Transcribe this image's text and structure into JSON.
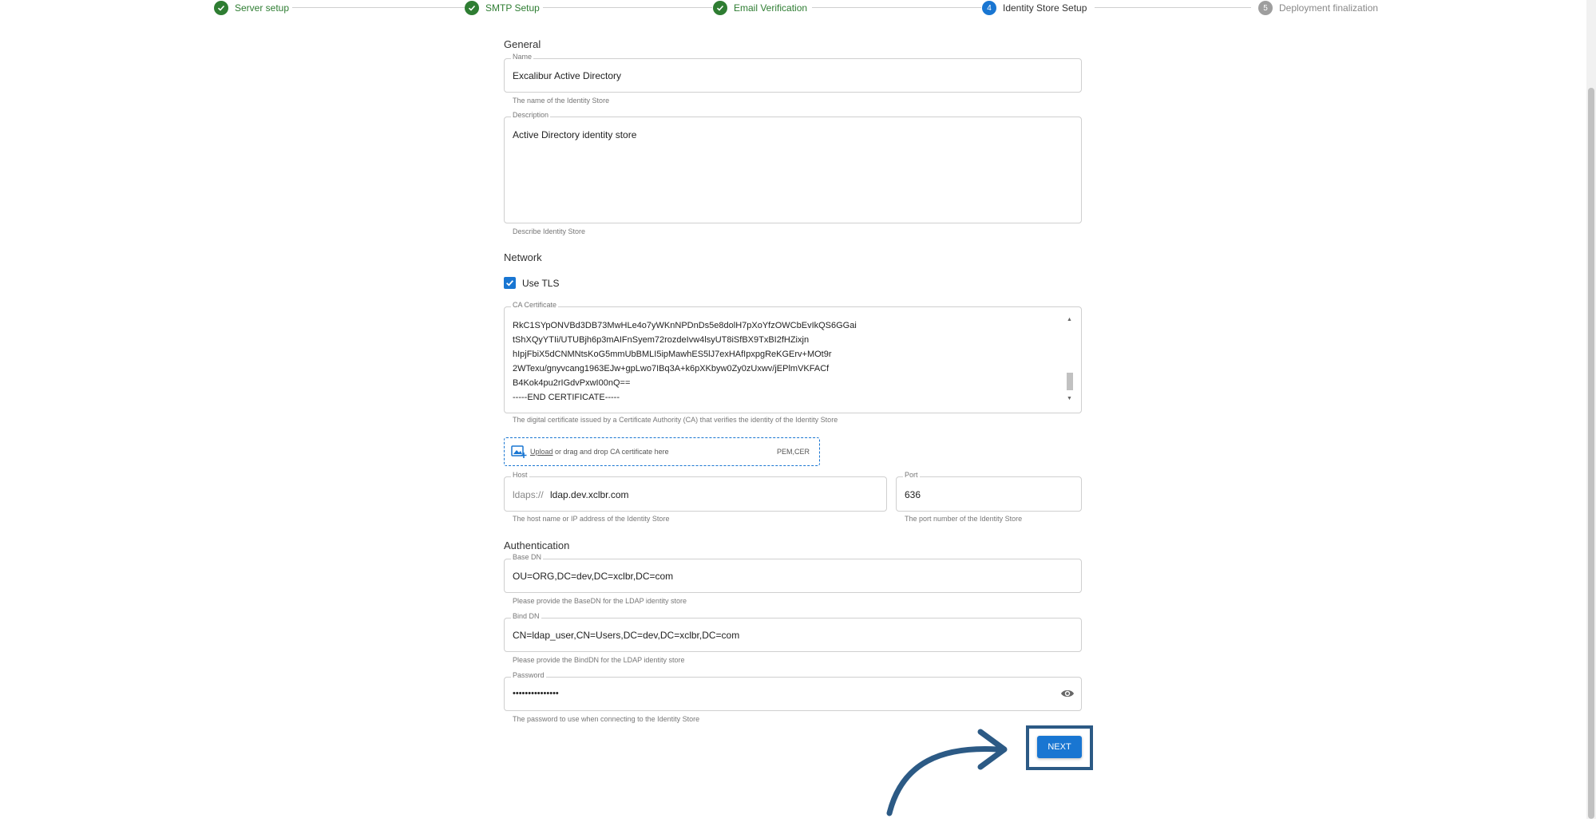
{
  "stepper": {
    "steps": [
      {
        "number": "1",
        "label": "Server setup",
        "state": "done"
      },
      {
        "number": "2",
        "label": "SMTP Setup",
        "state": "done"
      },
      {
        "number": "3",
        "label": "Email Verification",
        "state": "done"
      },
      {
        "number": "4",
        "label": "Identity Store Setup",
        "state": "active"
      },
      {
        "number": "5",
        "label": "Deployment finalization",
        "state": "pending"
      }
    ]
  },
  "general": {
    "title": "General",
    "name": {
      "label": "Name",
      "value": "Excalibur Active Directory",
      "helper": "The name of the Identity Store"
    },
    "description": {
      "label": "Description",
      "value": "Active Directory identity store",
      "helper": "Describe Identity Store"
    }
  },
  "network": {
    "title": "Network",
    "use_tls": {
      "label": "Use TLS",
      "checked": true
    },
    "ca_certificate": {
      "label": "CA Certificate",
      "lines": [
        "RkC1SYpONVBd3DB73MwHLe4o7yWKnNPDnDs5e8dolH7pXoYfzOWCbEvIkQS6GGai",
        "tShXQyYTIi/UTUBjh6p3mAIFnSyem72rozdeIvw4lsyUT8iSfBX9TxBI2fHZixjn",
        "hIpjFbiX5dCNMNtsKoG5mmUbBMLI5ipMawhES5lJ7exHAfIpxpgReKGErv+MOt9r",
        "2WTexu/gnyvcang1963EJw+gpLwo7IBq3A+k6pXKbyw0Zy0zUxwv/jEPlmVKFACf",
        "B4Kok4pu2rIGdvPxwI00nQ==",
        "-----END CERTIFICATE-----"
      ],
      "helper": "The digital certificate issued by a Certificate Authority (CA) that verifies the identity of the Identity Store"
    },
    "upload": {
      "link": "Upload",
      "text": " or drag and drop CA certificate here",
      "formats": "PEM,CER"
    },
    "host": {
      "label": "Host",
      "prefix": "ldaps://",
      "value": "ldap.dev.xclbr.com",
      "helper": "The host name or IP address of the Identity Store"
    },
    "port": {
      "label": "Port",
      "value": "636",
      "helper": "The port number of the Identity Store"
    }
  },
  "authentication": {
    "title": "Authentication",
    "base_dn": {
      "label": "Base DN",
      "value": "OU=ORG,DC=dev,DC=xclbr,DC=com",
      "helper": "Please provide the BaseDN for the LDAP identity store"
    },
    "bind_dn": {
      "label": "Bind DN",
      "value": "CN=ldap_user,CN=Users,DC=dev,DC=xclbr,DC=com",
      "helper": "Please provide the BindDN for the LDAP identity store"
    },
    "password": {
      "label": "Password",
      "value": "•••••••••••••••",
      "helper": "The password to use when connecting to the Identity Store"
    }
  },
  "actions": {
    "next_label": "NEXT"
  },
  "colors": {
    "primary": "#1976d2",
    "success": "#2e7d32",
    "pending": "#9e9e9e",
    "annotation": "#2c5a85"
  }
}
